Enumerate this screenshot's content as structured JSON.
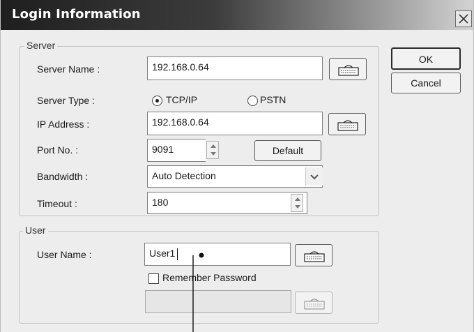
{
  "window": {
    "title": "Login Information",
    "close_icon": "close-icon"
  },
  "server": {
    "group_label": "Server",
    "server_name_label": "Server Name :",
    "server_name_value": "192.168.0.64",
    "server_type_label": "Server Type :",
    "server_type_options": [
      "TCP/IP",
      "PSTN"
    ],
    "server_type_selected": "TCP/IP",
    "ip_address_label": "IP Address :",
    "ip_address_value": "192.168.0.64",
    "port_label": "Port No. :",
    "port_value": "9091",
    "default_button": "Default",
    "bandwidth_label": "Bandwidth :",
    "bandwidth_value": "Auto Detection",
    "timeout_label": "Timeout :",
    "timeout_value": "180"
  },
  "user": {
    "group_label": "User",
    "user_name_label": "User Name :",
    "user_name_value": "User1",
    "remember_password_label": "Remember Password",
    "remember_password_checked": false,
    "password_value": ""
  },
  "actions": {
    "ok_label": "OK",
    "cancel_label": "Cancel"
  },
  "icons": {
    "keyboard": "keyboard-icon",
    "spin_up": "spin-up-icon",
    "spin_down": "spin-down-icon",
    "dropdown": "chevron-down-icon"
  }
}
